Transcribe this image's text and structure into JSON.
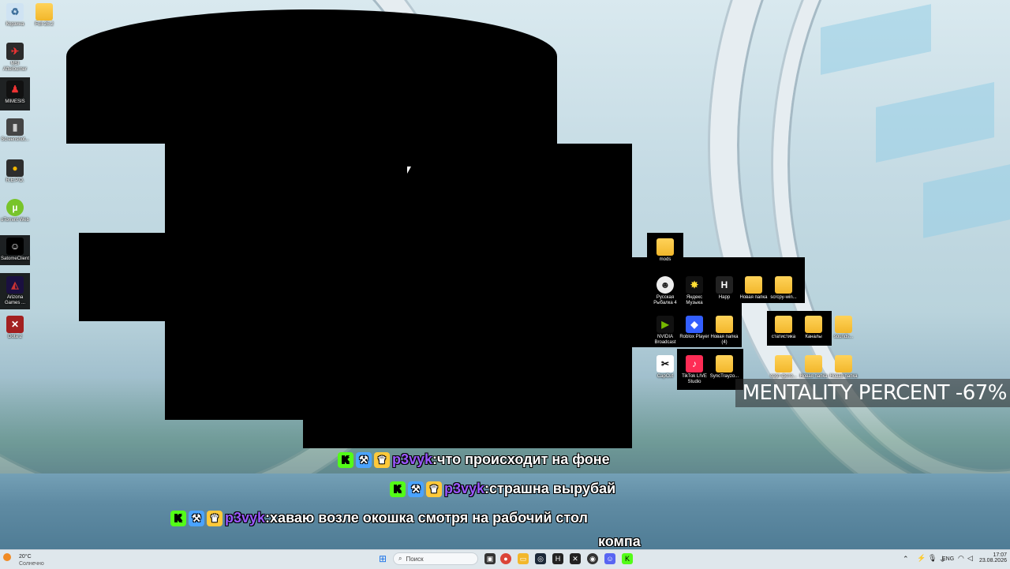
{
  "desktop_icons": {
    "recycle_bin": "Корзина",
    "folder_full": "Full-26.2",
    "msi_afterburner": "MSI Afterburner",
    "mimesis": "MIMESIS",
    "screenshot": "Screenshot...",
    "repo": "R.E.P.O.",
    "utorrent": "uTorrent Web",
    "satomi": "SatomeClient",
    "arizona": "Arizona Games ...",
    "dota": "Dota 2",
    "mods": "mods",
    "russian_fishing": "Русская Рыбалка 4",
    "yandex_music": "Яндекс Музыка",
    "happ": "Happ",
    "new_folder_1": "Новая папка",
    "scrcpy": "scrcpy-win...",
    "nvidia": "NVIDIA Broadcast",
    "roblox": "Roblox Player",
    "new_folder_4": "Новая папка (4)",
    "stats": "статистика",
    "channels": "Каналы",
    "sounds": "sounds...",
    "capcut": "CapCut",
    "tiktok": "TikTok LIVE Studio",
    "synctrayzor": "SyncTrayzo...",
    "folder_a": "сорт-фото...",
    "folder_b": "Новая папка",
    "folder_c": "Новая папка"
  },
  "overlay": {
    "mentality": "MENTALITY PERCENT -67%"
  },
  "chat": [
    {
      "nick": "p3vyk",
      "sep": ":",
      "text": " что происходит на фоне"
    },
    {
      "nick": "p3vyk",
      "sep": ":",
      "text": " страшна вырубай"
    },
    {
      "nick": "p3vyk",
      "sep": ":",
      "text": " хаваю возле окошка смотря на рабочий стол"
    },
    {
      "text": "компа"
    }
  ],
  "taskbar": {
    "weather_temp": "20°C",
    "weather_desc": "Солнечно",
    "search_placeholder": "Поиск",
    "language": "ENG",
    "time": "17:07",
    "date": "23.08.2026"
  },
  "colors": {
    "accent_green": "#53fc18",
    "nick_purple": "#9b59ff"
  }
}
